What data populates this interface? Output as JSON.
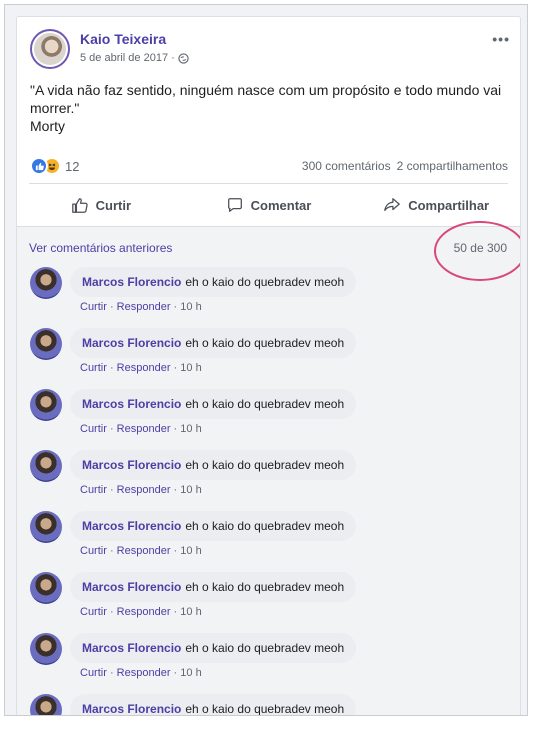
{
  "post": {
    "author": "Kaio Teixeira",
    "date": "5 de abril de 2017",
    "meta_separator": "·",
    "more_label": "•••",
    "text_lines": [
      "\"A vida não faz sentido, ninguém nasce com um propósito e todo mundo vai",
      "morrer.\"",
      "Morty"
    ],
    "reaction_count": "12",
    "comments_count": "300 comentários",
    "shares_count": "2 compartilhamentos",
    "reactions": [
      "like-icon",
      "haha-icon"
    ]
  },
  "actions": {
    "like": "Curtir",
    "comment": "Comentar",
    "share": "Compartilhar"
  },
  "comments_section": {
    "view_previous": "Ver comentários anteriores",
    "counter": "50 de 300",
    "highlight_color": "#d9487a",
    "items": [
      {
        "author": "Marcos Florencio",
        "text": "eh o kaio do quebradev meoh",
        "like": "Curtir",
        "reply": "Responder",
        "time": "10 h"
      },
      {
        "author": "Marcos Florencio",
        "text": "eh o kaio do quebradev meoh",
        "like": "Curtir",
        "reply": "Responder",
        "time": "10 h"
      },
      {
        "author": "Marcos Florencio",
        "text": "eh o kaio do quebradev meoh",
        "like": "Curtir",
        "reply": "Responder",
        "time": "10 h"
      },
      {
        "author": "Marcos Florencio",
        "text": "eh o kaio do quebradev meoh",
        "like": "Curtir",
        "reply": "Responder",
        "time": "10 h"
      },
      {
        "author": "Marcos Florencio",
        "text": "eh o kaio do quebradev meoh",
        "like": "Curtir",
        "reply": "Responder",
        "time": "10 h"
      },
      {
        "author": "Marcos Florencio",
        "text": "eh o kaio do quebradev meoh",
        "like": "Curtir",
        "reply": "Responder",
        "time": "10 h"
      },
      {
        "author": "Marcos Florencio",
        "text": "eh o kaio do quebradev meoh",
        "like": "Curtir",
        "reply": "Responder",
        "time": "10 h"
      },
      {
        "author": "Marcos Florencio",
        "text": "eh o kaio do quebradev meoh",
        "like": "",
        "reply": "",
        "time": ""
      }
    ]
  },
  "colors": {
    "accent": "#4b3fa5",
    "like": "#3578e5",
    "haha": "#f7b125"
  }
}
